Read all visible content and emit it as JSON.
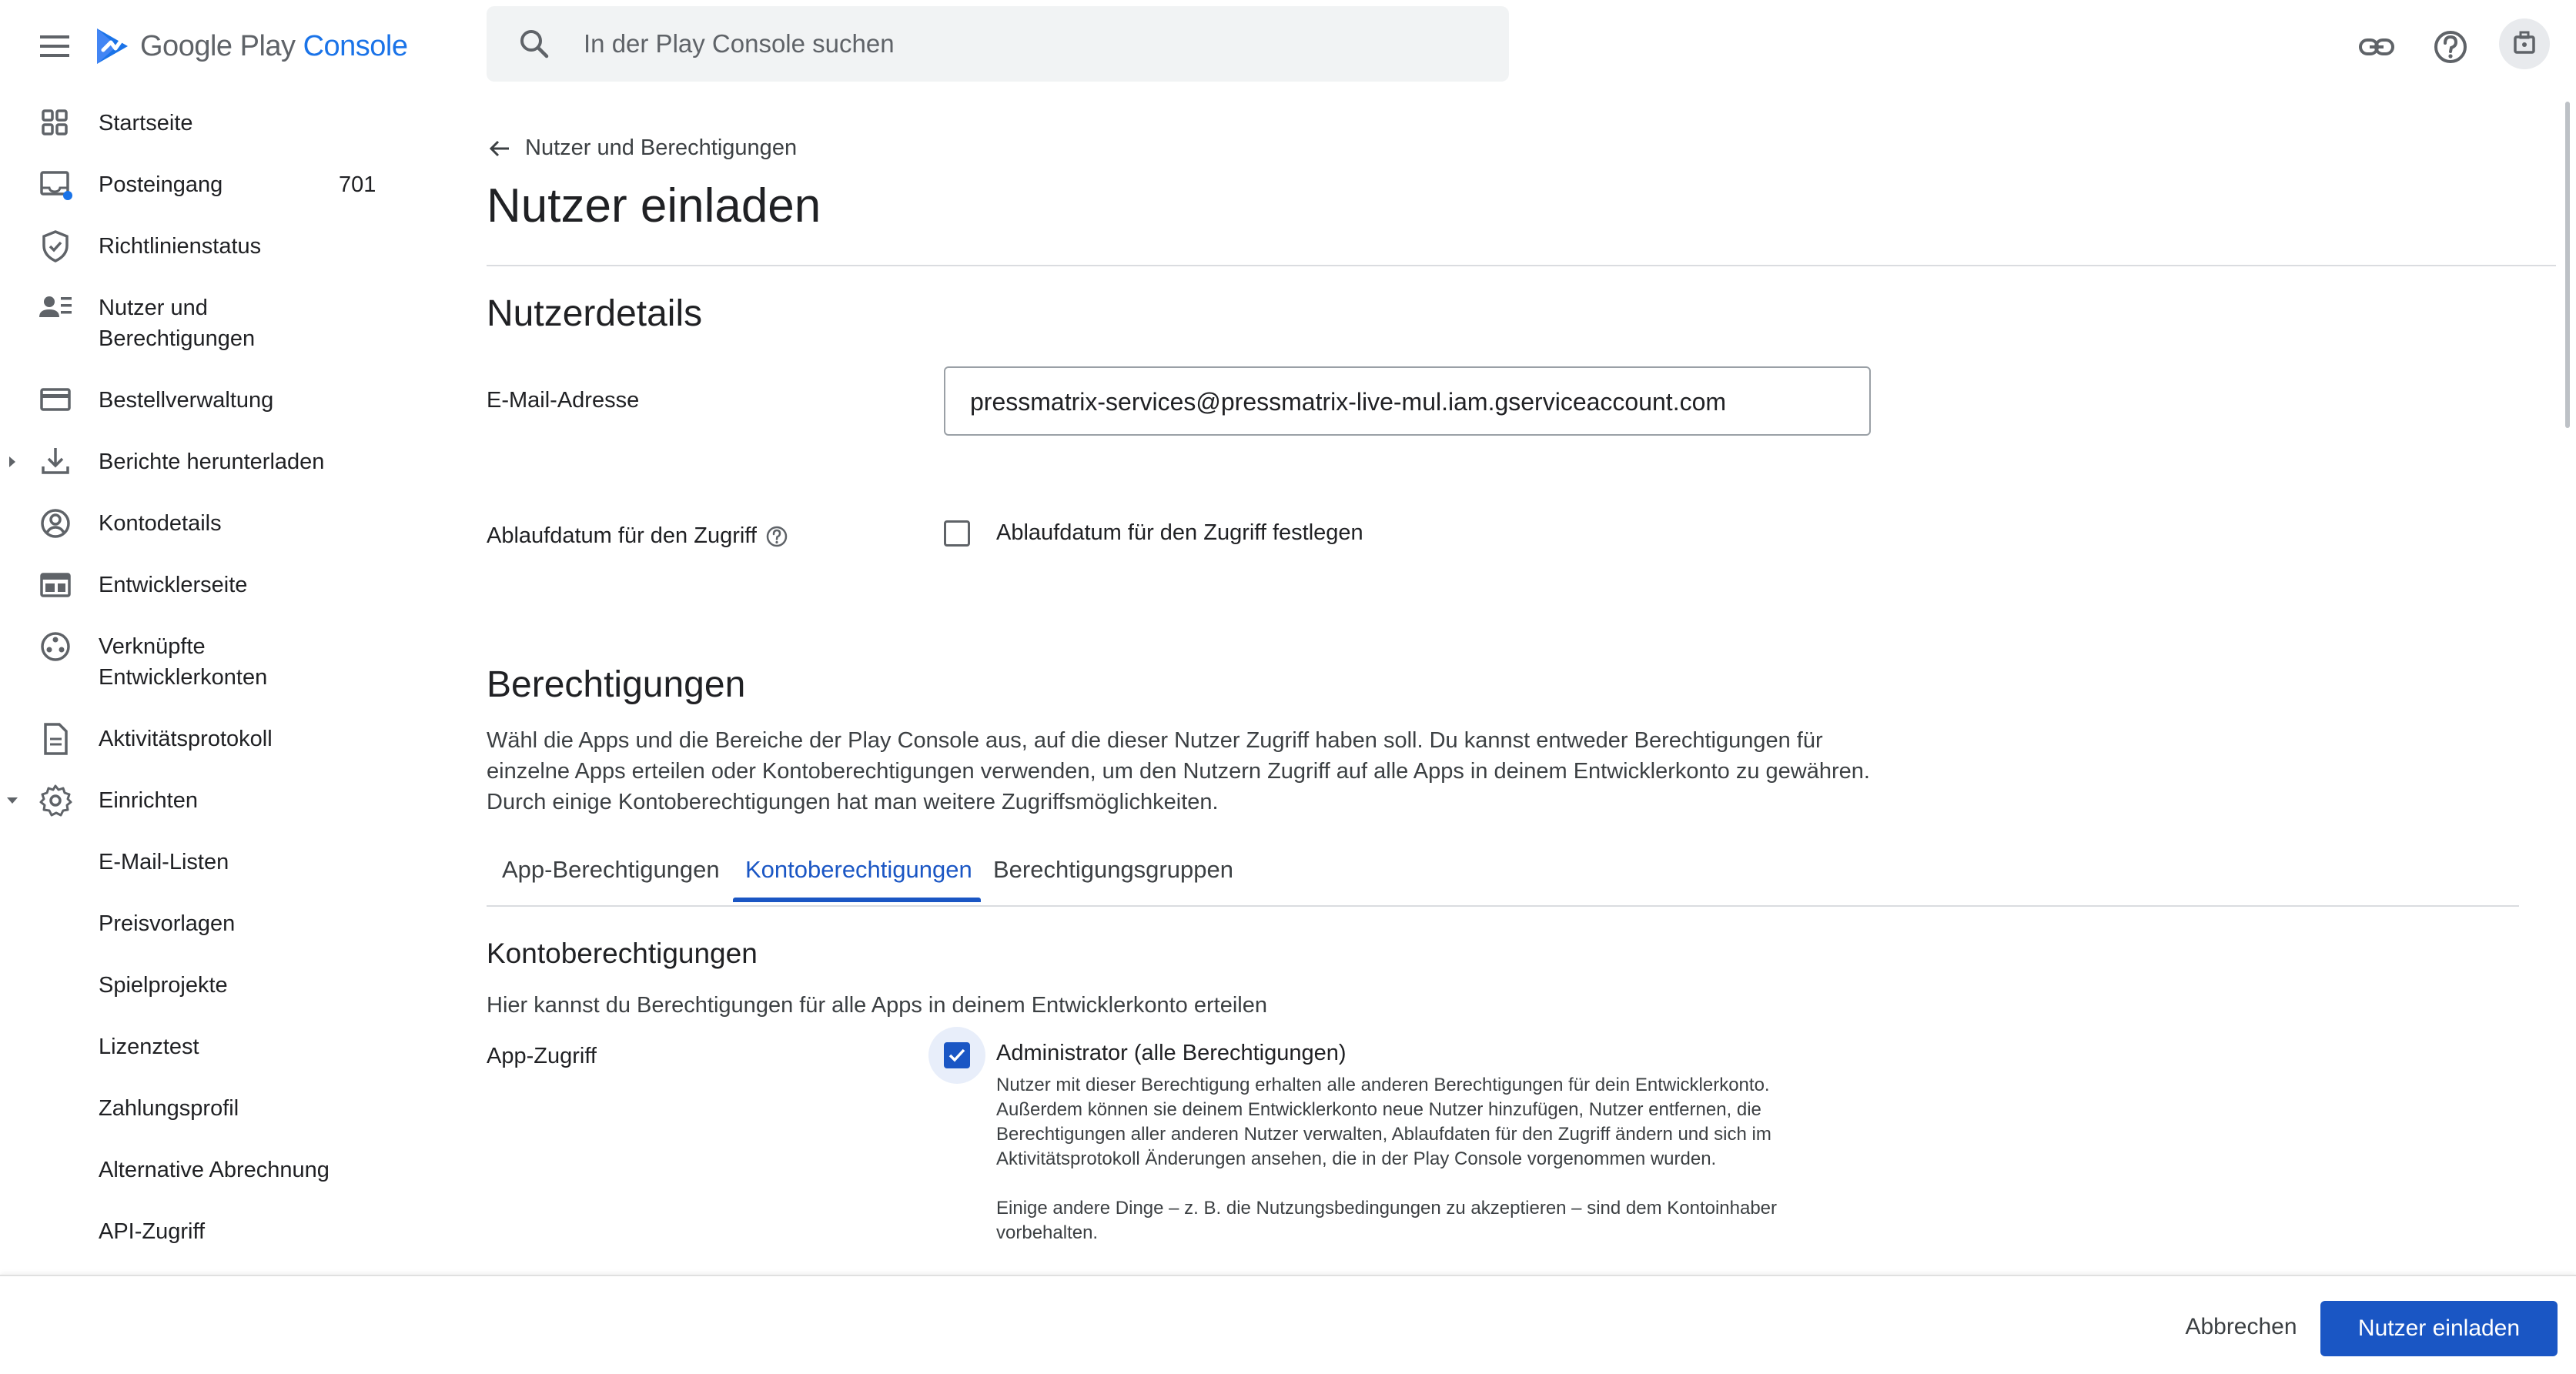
{
  "app": {
    "logo_text_google_play": "Google Play",
    "logo_text_console": "Console",
    "search_placeholder": "In der Play Console suchen"
  },
  "sidebar": {
    "items": [
      {
        "label": "Startseite",
        "icon": "dashboard-icon"
      },
      {
        "label": "Posteingang",
        "icon": "inbox-icon",
        "count": "701"
      },
      {
        "label": "Richtlinienstatus",
        "icon": "shield-check-icon"
      },
      {
        "label": "Nutzer und",
        "label2": "Berechtigungen",
        "icon": "manage-accounts-icon"
      },
      {
        "label": "Bestellverwaltung",
        "icon": "credit-card-icon"
      },
      {
        "label": "Berichte herunterladen",
        "icon": "download-icon"
      },
      {
        "label": "Kontodetails",
        "icon": "account-circle-icon"
      },
      {
        "label": "Entwicklerseite",
        "icon": "web-page-icon"
      },
      {
        "label": "Verknüpfte",
        "label2": "Entwicklerkonten",
        "icon": "linked-accounts-icon"
      },
      {
        "label": "Aktivitätsprotokoll",
        "icon": "document-icon"
      },
      {
        "label": "Einrichten",
        "icon": "gear-icon"
      },
      {
        "label": "E-Mail-Listen"
      },
      {
        "label": "Preisvorlagen"
      },
      {
        "label": "Spielprojekte"
      },
      {
        "label": "Lizenztest"
      },
      {
        "label": "Zahlungsprofil"
      },
      {
        "label": "Alternative Abrechnung"
      },
      {
        "label": "API-Zugriff"
      }
    ]
  },
  "main": {
    "back_label": "Nutzer und Berechtigungen",
    "page_title": "Nutzer einladen",
    "details": {
      "heading": "Nutzerdetails",
      "email_label": "E-Mail-Adresse",
      "email_value": "pressmatrix-services@pressmatrix-live-mul.iam.gserviceaccount.com",
      "expiry_label": "Ablaufdatum für den Zugriff",
      "expiry_checkbox_label": "Ablaufdatum für den Zugriff festlegen"
    },
    "permissions": {
      "heading": "Berechtigungen",
      "description_1": "Wähl die Apps und die Bereiche der Play Console aus, auf die dieser Nutzer Zugriff haben soll. Du kannst entweder Berechtigungen für",
      "description_2": "einzelne Apps erteilen oder Kontoberechtigungen verwenden, um den Nutzern Zugriff auf alle Apps in deinem Entwicklerkonto zu gewähren.",
      "description_3": "Durch einige Kontoberechtigungen hat man weitere Zugriffsmöglichkeiten.",
      "tabs": [
        {
          "label": "App-Berechtigungen",
          "active": false
        },
        {
          "label": "Kontoberechtigungen",
          "active": true
        },
        {
          "label": "Berechtigungsgruppen",
          "active": false
        }
      ],
      "account_heading": "Kontoberechtigungen",
      "account_subtitle": "Hier kannst du Berechtigungen für alle Apps in deinem Entwicklerkonto erteilen",
      "app_access_label": "App-Zugriff",
      "admin_label": "Administrator (alle Berechtigungen)",
      "admin_desc_1": "Nutzer mit dieser Berechtigung erhalten alle anderen Berechtigungen für dein Entwicklerkonto.",
      "admin_desc_2": "Außerdem können sie deinem Entwicklerkonto neue Nutzer hinzufügen, Nutzer entfernen, die",
      "admin_desc_3": "Berechtigungen aller anderen Nutzer verwalten, Ablaufdaten für den Zugriff ändern und sich im",
      "admin_desc_4": "Aktivitätsprotokoll Änderungen ansehen, die in der Play Console vorgenommen wurden.",
      "admin_desc_5": "Einige andere Dinge – z. B. die Nutzungsbedingungen zu akzeptieren – sind dem Kontoinhaber",
      "admin_desc_6": "vorbehalten."
    }
  },
  "footer": {
    "cancel_label": "Abbrechen",
    "submit_label": "Nutzer einladen"
  },
  "colors": {
    "accent": "#1a56c4",
    "brand_blue": "#1a73e8"
  }
}
